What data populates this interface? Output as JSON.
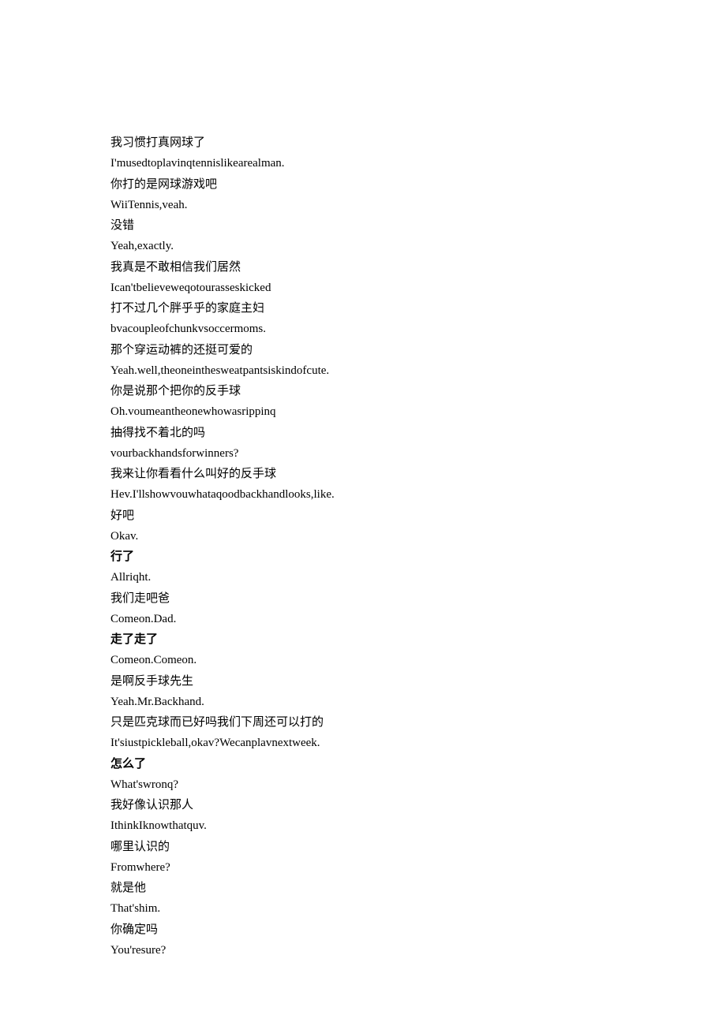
{
  "lines": [
    {
      "text": "我习惯打真网球了",
      "bold": false
    },
    {
      "text": "I'musedtoplavinqtennislikearealman.",
      "bold": false
    },
    {
      "text": "你打的是网球游戏吧",
      "bold": false
    },
    {
      "text": "WiiTennis,veah.",
      "bold": false
    },
    {
      "text": "没错",
      "bold": false
    },
    {
      "text": "Yeah,exactly.",
      "bold": false
    },
    {
      "text": "我真是不敢相信我们居然",
      "bold": false
    },
    {
      "text": "Ican'tbelieveweqotourasseskicked",
      "bold": false
    },
    {
      "text": "打不过几个胖乎乎的家庭主妇",
      "bold": false
    },
    {
      "text": "bvacoupleofchunkvsoccermoms.",
      "bold": false
    },
    {
      "text": "那个穿运动裤的还挺可爱的",
      "bold": false
    },
    {
      "text": "Yeah.well,theoneinthesweatpantsiskindofcute.",
      "bold": false
    },
    {
      "text": "你是说那个把你的反手球",
      "bold": false
    },
    {
      "text": "Oh.voumeantheonewhowasrippinq",
      "bold": false
    },
    {
      "text": "抽得找不着北的吗",
      "bold": false
    },
    {
      "text": "vourbackhandsforwinners?",
      "bold": false
    },
    {
      "text": "我来让你看看什么叫好的反手球",
      "bold": false
    },
    {
      "text": "Hev.I'llshowvouwhataqoodbackhandlooks,like.",
      "bold": false
    },
    {
      "text": "好吧",
      "bold": false
    },
    {
      "text": "Okav.",
      "bold": false
    },
    {
      "text": "行了",
      "bold": true
    },
    {
      "text": "Allriqht.",
      "bold": false
    },
    {
      "text": "我们走吧爸",
      "bold": false
    },
    {
      "text": "Comeon.Dad.",
      "bold": false
    },
    {
      "text": "走了走了",
      "bold": true
    },
    {
      "text": "Comeon.Comeon.",
      "bold": false
    },
    {
      "text": "是啊反手球先生",
      "bold": false
    },
    {
      "text": "Yeah.Mr.Backhand.",
      "bold": false
    },
    {
      "text": "只是匹克球而已好吗我们下周还可以打的",
      "bold": false
    },
    {
      "text": "It'siustpickleball,okav?Wecanplavnextweek.",
      "bold": false
    },
    {
      "text": "怎么了",
      "bold": true
    },
    {
      "text": "What'swronq?",
      "bold": false
    },
    {
      "text": "我好像认识那人",
      "bold": false
    },
    {
      "text": "IthinkIknowthatquv.",
      "bold": false
    },
    {
      "text": "哪里认识的",
      "bold": false
    },
    {
      "text": "Fromwhere?",
      "bold": false
    },
    {
      "text": "就是他",
      "bold": false
    },
    {
      "text": "That'shim.",
      "bold": false
    },
    {
      "text": "你确定吗",
      "bold": false
    },
    {
      "text": "You'resure?",
      "bold": false
    }
  ]
}
